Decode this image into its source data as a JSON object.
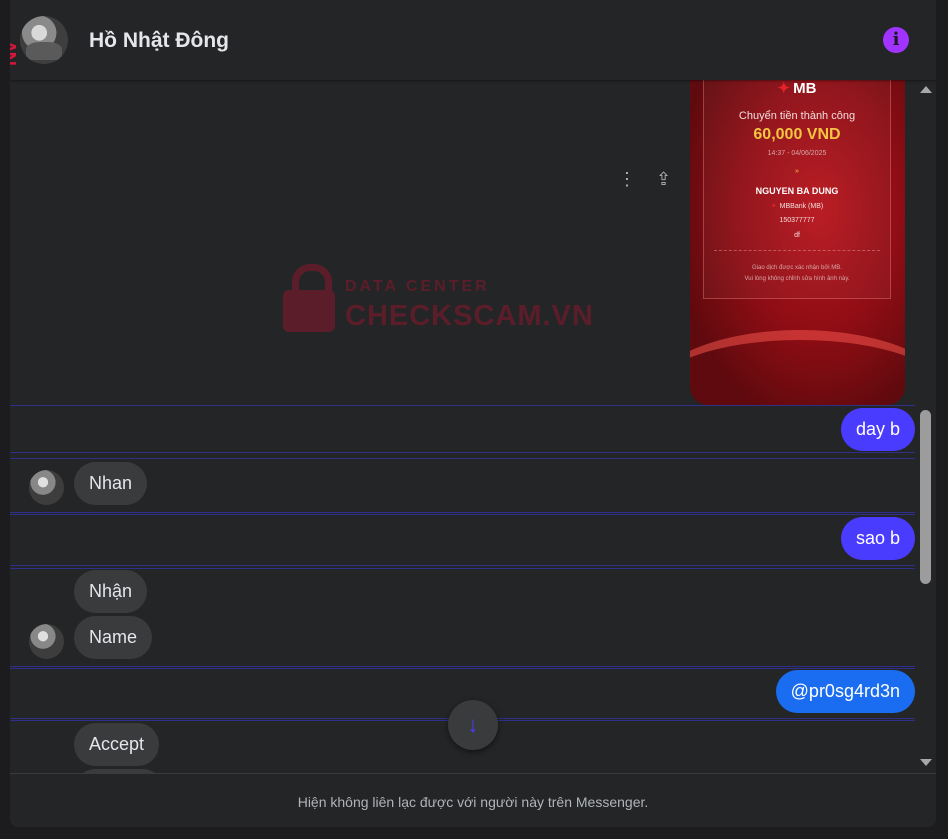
{
  "header": {
    "title": "Hồ Nhật Đông",
    "info_icon": "info-icon"
  },
  "receipt": {
    "bank": "MB",
    "status": "Chuyển tiền thành công",
    "amount": "60,000 VND",
    "time": "14:37 - 04/06/2025",
    "recipient": "NGUYEN BA DUNG",
    "recipient_bank": "MBBank (MB)",
    "account": "150377777",
    "memo": "df",
    "note_1": "Giao dịch được xác nhận bởi MB.",
    "note_2": "Vui lòng không chỉnh sửa hình ảnh này."
  },
  "watermark": {
    "small": "DATA CENTER",
    "big": "CHECKSCAM.VN"
  },
  "messages": [
    {
      "from": "me",
      "text": "day b"
    },
    {
      "from": "them",
      "text": "Nhan"
    },
    {
      "from": "me",
      "text": "sao b"
    },
    {
      "from": "them",
      "text": "Nhận"
    },
    {
      "from": "them",
      "text": "Name"
    },
    {
      "from": "me",
      "text": "@pr0sg4rd3n"
    },
    {
      "from": "them",
      "text": "Accept"
    }
  ],
  "footer": {
    "text": "Hiện không liên lạc được với người này trên Messenger."
  },
  "colors": {
    "outgoing": "#4a3cff",
    "outgoing_alt": "#1a6cf0",
    "incoming": "#3a3b3c",
    "info": "#a033ff",
    "background": "#242526"
  }
}
